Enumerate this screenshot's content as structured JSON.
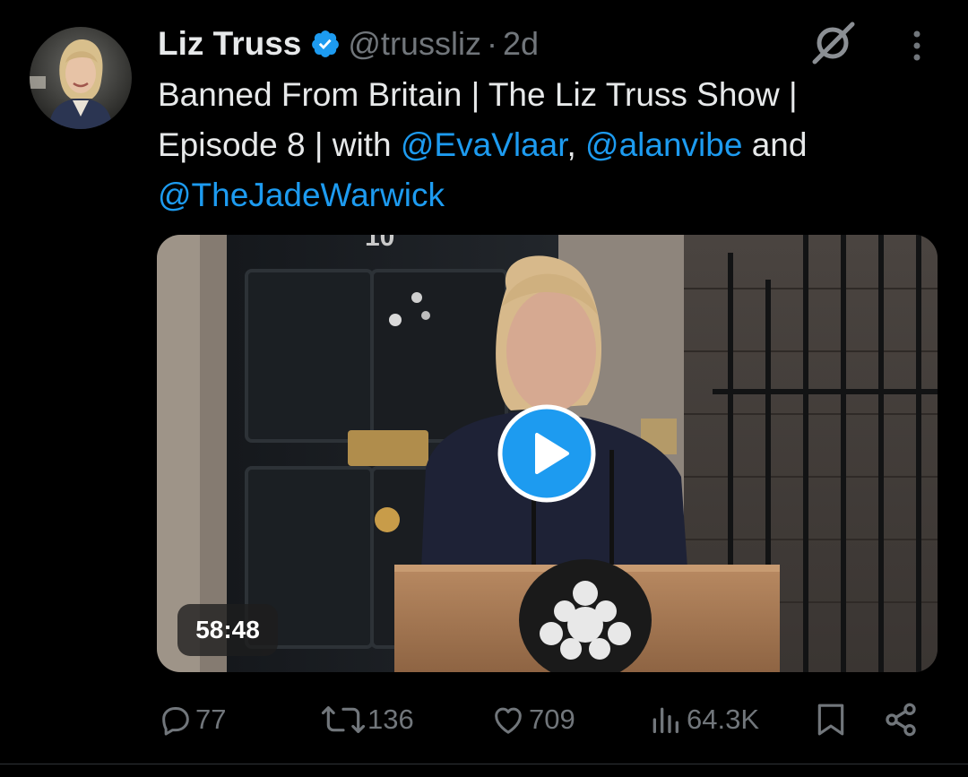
{
  "post": {
    "author_name": "Liz Truss",
    "handle": "@trussliz",
    "separator": "·",
    "age": "2d",
    "text_parts": {
      "line1": "Banned From Britain | The Liz Truss Show |",
      "line2_prefix": "Episode 8 | with ",
      "mention1": "@EvaVlaar",
      "comma": ",",
      "mention2": "@alanvibe",
      "and": " and",
      "mention3": "@TheJadeWarwick"
    },
    "video": {
      "duration": "58:48"
    },
    "actions": {
      "replies": "77",
      "reposts": "136",
      "likes": "709",
      "views": "64.3K"
    }
  },
  "icons": {
    "verified": "verified-badge-icon",
    "grok": "grok-icon",
    "more": "more-vertical-icon",
    "play": "play-icon",
    "reply": "reply-icon",
    "repost": "repost-icon",
    "like": "heart-icon",
    "views": "views-chart-icon",
    "bookmark": "bookmark-icon",
    "share": "share-icon"
  },
  "colors": {
    "background": "#000000",
    "text": "#e7e9ea",
    "secondary": "#71767b",
    "accent": "#1d9bf0"
  }
}
